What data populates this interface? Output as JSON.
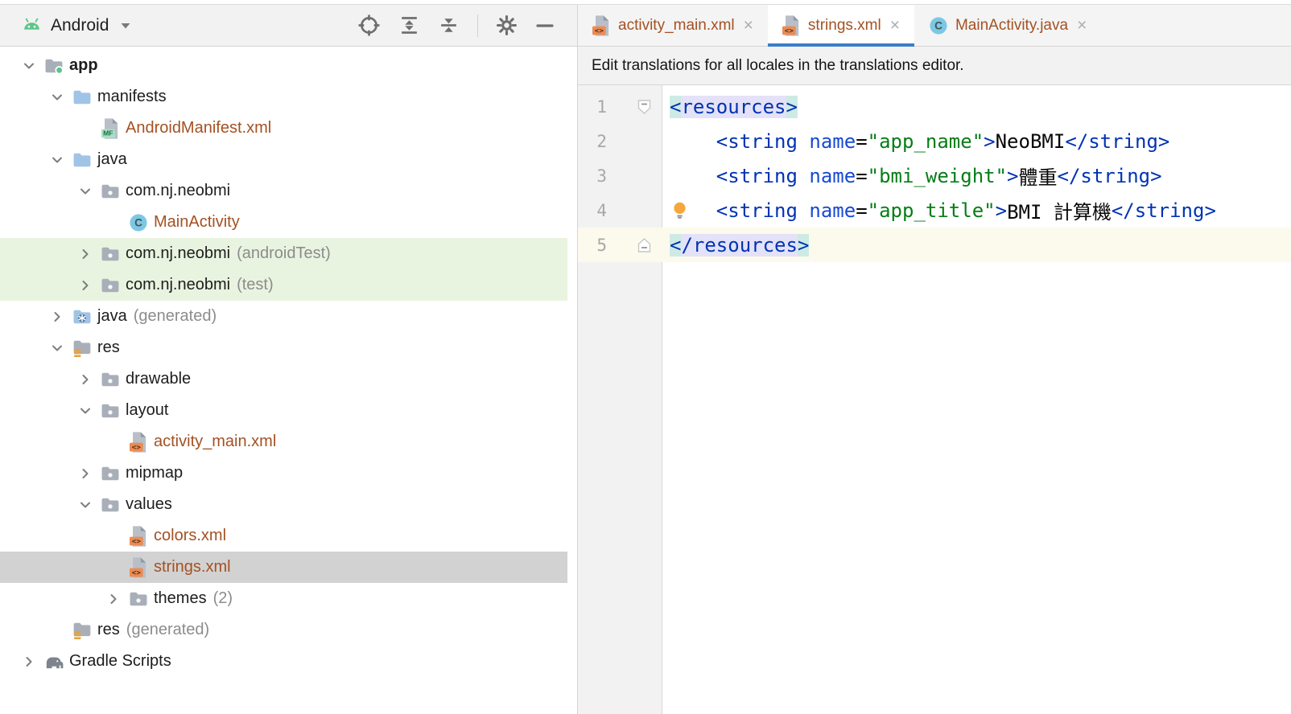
{
  "colors": {
    "accent_blue": "#3b7ec8",
    "filename_rust": "#a45122",
    "green_row": "#e9f4e0",
    "selected_row": "#d2d2d2",
    "caret_line": "#fcfaec",
    "tag_blue": "#0033b3",
    "attr_blue": "#174ad4",
    "string_green": "#067d17",
    "line_number": "#a8a8a8",
    "suffix_gray": "#8c8c8c",
    "android_green": "#5fc689",
    "folder_blue": "#a0c4e6",
    "folder_gray": "#a9afb9",
    "xml_badge_orange": "#ec8b53",
    "mf_badge_green": "#a9e0c4",
    "class_circle_blue": "#7cc8e3",
    "bulb_orange": "#f5a83a",
    "toolbar_icon_gray": "#6e6e6e"
  },
  "panel_toolbar": {
    "scope_label": "Android",
    "actions": [
      "locate",
      "expand-all",
      "collapse-all",
      "divider",
      "settings",
      "hide-panel"
    ]
  },
  "tree": {
    "items": [
      {
        "label": "app",
        "icon": "folder-app",
        "chevron": "down",
        "indent": 0,
        "bold": true
      },
      {
        "label": "manifests",
        "icon": "folder-blue",
        "chevron": "down",
        "indent": 1
      },
      {
        "label": "AndroidManifest.xml",
        "icon": "file-manifest",
        "chevron": "none",
        "indent": 2,
        "color": "rust"
      },
      {
        "label": "java",
        "icon": "folder-blue",
        "chevron": "down",
        "indent": 1
      },
      {
        "label": "com.nj.neobmi",
        "icon": "folder-package",
        "chevron": "down",
        "indent": 2
      },
      {
        "label": "MainActivity",
        "icon": "class",
        "chevron": "none",
        "indent": 3,
        "color": "rust"
      },
      {
        "label": "com.nj.neobmi",
        "suffix": "(androidTest)",
        "icon": "folder-package",
        "chevron": "right",
        "indent": 2,
        "highlight": "green"
      },
      {
        "label": "com.nj.neobmi",
        "suffix": "(test)",
        "icon": "folder-package",
        "chevron": "right",
        "indent": 2,
        "highlight": "green"
      },
      {
        "label": "java",
        "suffix": "(generated)",
        "icon": "folder-generated",
        "chevron": "right",
        "indent": 1
      },
      {
        "label": "res",
        "icon": "folder-res",
        "chevron": "down",
        "indent": 1
      },
      {
        "label": "drawable",
        "icon": "folder-package",
        "chevron": "right",
        "indent": 2
      },
      {
        "label": "layout",
        "icon": "folder-package",
        "chevron": "down",
        "indent": 2
      },
      {
        "label": "activity_main.xml",
        "icon": "file-xml",
        "chevron": "none",
        "indent": 3,
        "color": "rust"
      },
      {
        "label": "mipmap",
        "icon": "folder-package",
        "chevron": "right",
        "indent": 2
      },
      {
        "label": "values",
        "icon": "folder-package",
        "chevron": "down",
        "indent": 2
      },
      {
        "label": "colors.xml",
        "icon": "file-xml",
        "chevron": "none",
        "indent": 3,
        "color": "rust"
      },
      {
        "label": "strings.xml",
        "icon": "file-xml",
        "chevron": "none",
        "indent": 3,
        "color": "rust",
        "highlight": "selected"
      },
      {
        "label": "themes",
        "suffix": "(2)",
        "icon": "folder-package",
        "chevron": "right",
        "indent": 3
      },
      {
        "label": "res",
        "suffix": "(generated)",
        "icon": "folder-res",
        "chevron": "none",
        "indent": 1
      },
      {
        "label": "Gradle Scripts",
        "icon": "gradle-elephant",
        "chevron": "right",
        "indent": 0
      }
    ]
  },
  "tabs": {
    "close_glyph": "×",
    "items": [
      {
        "label": "activity_main.xml",
        "icon": "file-xml",
        "active": false
      },
      {
        "label": "strings.xml",
        "icon": "file-xml",
        "active": true
      },
      {
        "label": "MainActivity.java",
        "icon": "class",
        "active": false
      }
    ]
  },
  "editor": {
    "banner": "Edit translations for all locales in the translations editor.",
    "lines": [
      {
        "n": "1",
        "fold": "top",
        "segs": [
          {
            "t": "<",
            "k": "tag",
            "h": "cyan"
          },
          {
            "t": "resources",
            "k": "tag",
            "h": "lav"
          },
          {
            "t": ">",
            "k": "tag",
            "h": "cyan"
          }
        ]
      },
      {
        "n": "2",
        "segs": [
          {
            "t": "    "
          },
          {
            "t": "<string",
            "k": "tag"
          },
          {
            "t": " "
          },
          {
            "t": "name",
            "k": "attr"
          },
          {
            "t": "="
          },
          {
            "t": "\"app_name\"",
            "k": "str"
          },
          {
            "t": ">",
            "k": "tag"
          },
          {
            "t": "NeoBMI",
            "k": "txt"
          },
          {
            "t": "</string>",
            "k": "tag"
          }
        ]
      },
      {
        "n": "3",
        "segs": [
          {
            "t": "    "
          },
          {
            "t": "<string",
            "k": "tag"
          },
          {
            "t": " "
          },
          {
            "t": "name",
            "k": "attr"
          },
          {
            "t": "="
          },
          {
            "t": "\"bmi_weight\"",
            "k": "str"
          },
          {
            "t": ">",
            "k": "tag"
          },
          {
            "t": "體重",
            "k": "txt"
          },
          {
            "t": "</string>",
            "k": "tag"
          }
        ]
      },
      {
        "n": "4",
        "bulb": true,
        "segs": [
          {
            "t": "    "
          },
          {
            "t": "<string",
            "k": "tag"
          },
          {
            "t": " "
          },
          {
            "t": "name",
            "k": "attr"
          },
          {
            "t": "="
          },
          {
            "t": "\"app_title\"",
            "k": "str"
          },
          {
            "t": ">",
            "k": "tag"
          },
          {
            "t": "BMI 計算機",
            "k": "txt"
          },
          {
            "t": "</string>",
            "k": "tag"
          }
        ]
      },
      {
        "n": "5",
        "fold": "bottom",
        "caret": true,
        "segs": [
          {
            "t": "<",
            "k": "tag",
            "h": "cyan"
          },
          {
            "t": "/resources",
            "k": "tag",
            "h": "lav"
          },
          {
            "t": ">",
            "k": "tag",
            "h": "cyan"
          }
        ]
      }
    ]
  }
}
